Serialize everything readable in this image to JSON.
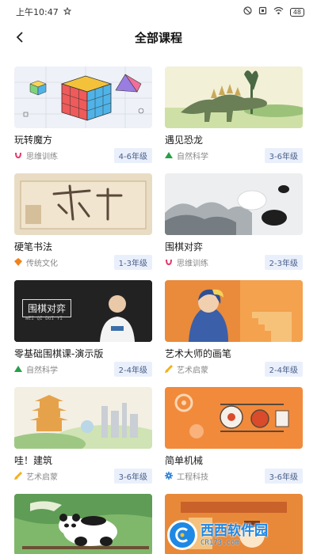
{
  "status_bar": {
    "time": "上午10:47",
    "battery": "48"
  },
  "header": {
    "title": "全部课程",
    "back_icon": "chevron-left-icon"
  },
  "courses": [
    {
      "title": "玩转魔方",
      "category": "思维训练",
      "grade": "4-6年级",
      "category_color": "#e5386b",
      "thumb": "rubiks-cube"
    },
    {
      "title": "遇见恐龙",
      "category": "自然科学",
      "grade": "3-6年级",
      "category_color": "#27a04a",
      "thumb": "dinosaur"
    },
    {
      "title": "硬笔书法",
      "category": "传统文化",
      "grade": "1-3年级",
      "category_color": "#f0831b",
      "thumb": "calligraphy"
    },
    {
      "title": "围棋对弈",
      "category": "思维训练",
      "grade": "2-3年级",
      "category_color": "#e5386b",
      "thumb": "go-stones"
    },
    {
      "title": "零基础围棋课-演示版",
      "category": "自然科学",
      "grade": "2-4年级",
      "category_color": "#27a04a",
      "thumb": "go-teacher"
    },
    {
      "title": "艺术大师的画笔",
      "category": "艺术启蒙",
      "grade": "2-4年级",
      "category_color": "#f2b01e",
      "thumb": "painting"
    },
    {
      "title": "哇！建筑",
      "category": "艺术启蒙",
      "grade": "3-6年级",
      "category_color": "#f2b01e",
      "thumb": "architecture"
    },
    {
      "title": "简单机械",
      "category": "工程科技",
      "grade": "3-6年级",
      "category_color": "#2b7fd6",
      "thumb": "machinery"
    },
    {
      "title": "",
      "category": "",
      "grade": "",
      "category_color": "#27a04a",
      "thumb": "panda"
    },
    {
      "title": "",
      "category": "",
      "grade": "",
      "category_color": "#f2b01e",
      "thumb": "orange-art"
    }
  ],
  "thumb_texts": {
    "go_banner": "围棋对弈",
    "go_banner_sub": "WEI QI DUI YI"
  },
  "watermark": {
    "main": "西西软件园",
    "sub": "CR173.com"
  }
}
